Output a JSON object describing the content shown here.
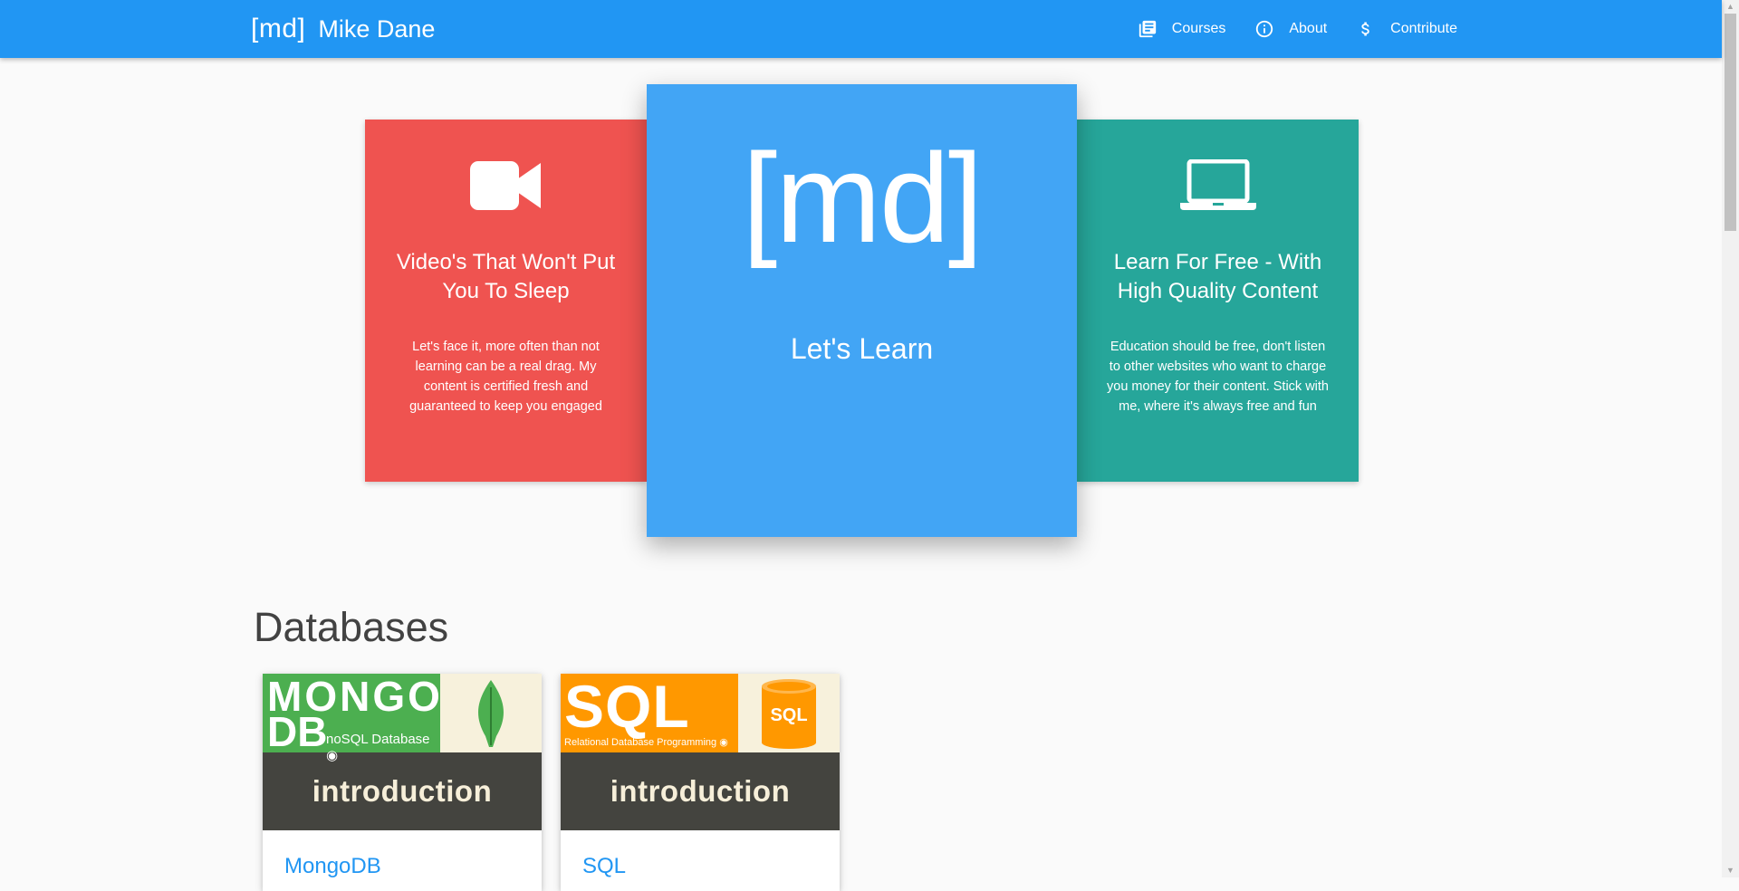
{
  "nav": {
    "logo": "[md]",
    "brand_name": "Mike Dane",
    "links": [
      {
        "label": "Courses",
        "icon": "library-books-icon"
      },
      {
        "label": "About",
        "icon": "info-icon"
      },
      {
        "label": "Contribute",
        "icon": "dollar-icon"
      }
    ]
  },
  "hero": {
    "left": {
      "icon": "videocam-icon",
      "title": "Video's That Won't Put You To Sleep",
      "text": "Let's face it, more often than not learning can be a real drag. My content is certified fresh and guaranteed to keep you engaged"
    },
    "center": {
      "logo": "[md]",
      "title": "Let's Learn"
    },
    "right": {
      "icon": "laptop-icon",
      "title": "Learn For Free - With High Quality Content",
      "text": "Education should be free, don't listen to other websites who want to charge you money for their content. Stick with me, where it's always free and fun"
    }
  },
  "sections": [
    {
      "title": "Databases",
      "courses": [
        {
          "name": "MongoDB",
          "thumb_big1": "MONGO",
          "thumb_big2": "DB",
          "thumb_small": "noSQL Database",
          "thumb_bottom": "introduction"
        },
        {
          "name": "SQL",
          "thumb_big": "SQL",
          "thumb_small": "Relational Database Programming",
          "thumb_badge": "SQL",
          "thumb_bottom": "introduction"
        }
      ]
    }
  ],
  "colors": {
    "navbar": "#2196f3",
    "card_red": "#ef5350",
    "card_blue": "#42a5f5",
    "card_teal": "#26a69a",
    "mongo_green": "#4caf50",
    "sql_orange": "#ff9800"
  }
}
